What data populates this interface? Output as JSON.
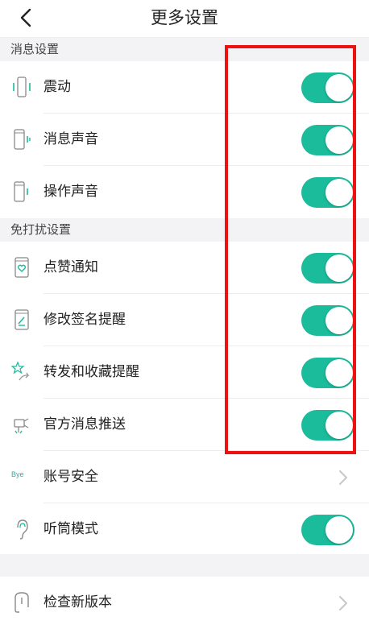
{
  "header": {
    "title": "更多设置",
    "back_icon": "chevron-left-icon"
  },
  "sections": {
    "message": "消息设置",
    "dnd": "免打扰设置"
  },
  "rows": {
    "vibrate": {
      "label": "震动",
      "icon": "vibrate-icon",
      "toggle_on": true
    },
    "message_sound": {
      "label": "消息声音",
      "icon": "phone-sound-icon",
      "toggle_on": true
    },
    "operation_sound": {
      "label": "操作声音",
      "icon": "phone-sound-icon",
      "toggle_on": true
    },
    "likes": {
      "label": "点赞通知",
      "icon": "heart-phone-icon",
      "toggle_on": true
    },
    "signature": {
      "label": "修改签名提醒",
      "icon": "edit-phone-icon",
      "toggle_on": true
    },
    "forward": {
      "label": "转发和收藏提醒",
      "icon": "star-share-icon",
      "toggle_on": true
    },
    "official": {
      "label": "官方消息推送",
      "icon": "megaphone-icon",
      "toggle_on": true
    },
    "account": {
      "label": "账号安全",
      "icon_text": "Bye",
      "icon": "bye-icon",
      "chevron": "chevron-right-icon"
    },
    "earpiece": {
      "label": "听筒模式",
      "icon": "ear-icon",
      "toggle_on": true
    },
    "update": {
      "label": "检查新版本",
      "icon": "check-version-icon",
      "chevron": "chevron-right-icon"
    }
  },
  "colors": {
    "accent": "#1abc9c",
    "section_bg": "#f3f3f5",
    "highlight": "#ee1111"
  }
}
